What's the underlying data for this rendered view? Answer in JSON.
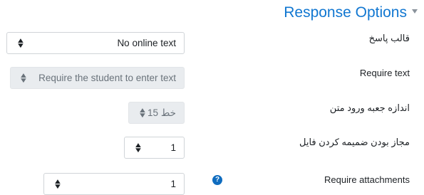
{
  "section": {
    "title": "Response Options"
  },
  "fields": [
    {
      "label": "قالب پاسخ",
      "value": "No online text"
    },
    {
      "label": "Require text",
      "value": "Require the student to enter text"
    },
    {
      "label": "اندازه جعبه ورود متن",
      "value": "15 خط"
    },
    {
      "label": "مجاز بودن ضمیمه کردن فایل",
      "value": "1"
    },
    {
      "label": "Require attachments",
      "value": "1"
    }
  ],
  "icons": {
    "collapse": "chevron-down-icon",
    "select": "sort-arrows-icon",
    "help": "question-circle-icon"
  },
  "colors": {
    "heading": "#1177d1",
    "help": "#0f6cbf"
  }
}
